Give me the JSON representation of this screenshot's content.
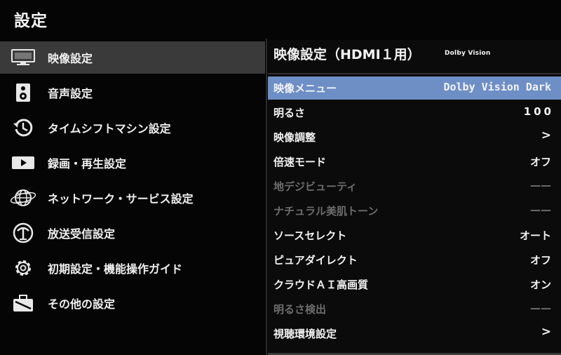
{
  "header": {
    "title": "設定"
  },
  "sidebar": {
    "items": [
      {
        "label": "映像設定",
        "icon": "tv-icon",
        "selected": true
      },
      {
        "label": "音声設定",
        "icon": "speaker-icon",
        "selected": false
      },
      {
        "label": "タイムシフトマシン設定",
        "icon": "timeshift-icon",
        "selected": false
      },
      {
        "label": "録画・再生設定",
        "icon": "play-icon",
        "selected": false
      },
      {
        "label": "ネットワーク・サービス設定",
        "icon": "globe-icon",
        "selected": false
      },
      {
        "label": "放送受信設定",
        "icon": "antenna-icon",
        "selected": false
      },
      {
        "label": "初期設定・機能操作ガイド",
        "icon": "gear-icon",
        "selected": false
      },
      {
        "label": "その他の設定",
        "icon": "toolbox-icon",
        "selected": false
      }
    ]
  },
  "panel": {
    "title": "映像設定（HDMI１用）",
    "badge": "Dolby Vision",
    "rows": [
      {
        "label": "映像メニュー",
        "value": "Dolby Vision Dark",
        "selected": true,
        "disabled": false
      },
      {
        "label": "明るさ",
        "value": "100",
        "selected": false,
        "disabled": false
      },
      {
        "label": "映像調整",
        "value": ">",
        "selected": false,
        "disabled": false
      },
      {
        "label": "倍速モード",
        "value": "オフ",
        "selected": false,
        "disabled": false
      },
      {
        "label": "地デジビューティ",
        "value": "——",
        "selected": false,
        "disabled": true
      },
      {
        "label": "ナチュラル美肌トーン",
        "value": "——",
        "selected": false,
        "disabled": true
      },
      {
        "label": "ソースセレクト",
        "value": "オート",
        "selected": false,
        "disabled": false
      },
      {
        "label": "ピュアダイレクト",
        "value": "オフ",
        "selected": false,
        "disabled": false
      },
      {
        "label": "クラウドＡＩ高画質",
        "value": "オン",
        "selected": false,
        "disabled": false
      },
      {
        "label": "明るさ検出",
        "value": "——",
        "selected": false,
        "disabled": true
      },
      {
        "label": "視聴環境設定",
        "value": ">",
        "selected": false,
        "disabled": false
      }
    ]
  },
  "colors": {
    "background": "#050505",
    "selected_sidebar": "#3a3a3a",
    "selected_row": "#6e8fc6",
    "disabled_text": "#6d6d6d"
  }
}
